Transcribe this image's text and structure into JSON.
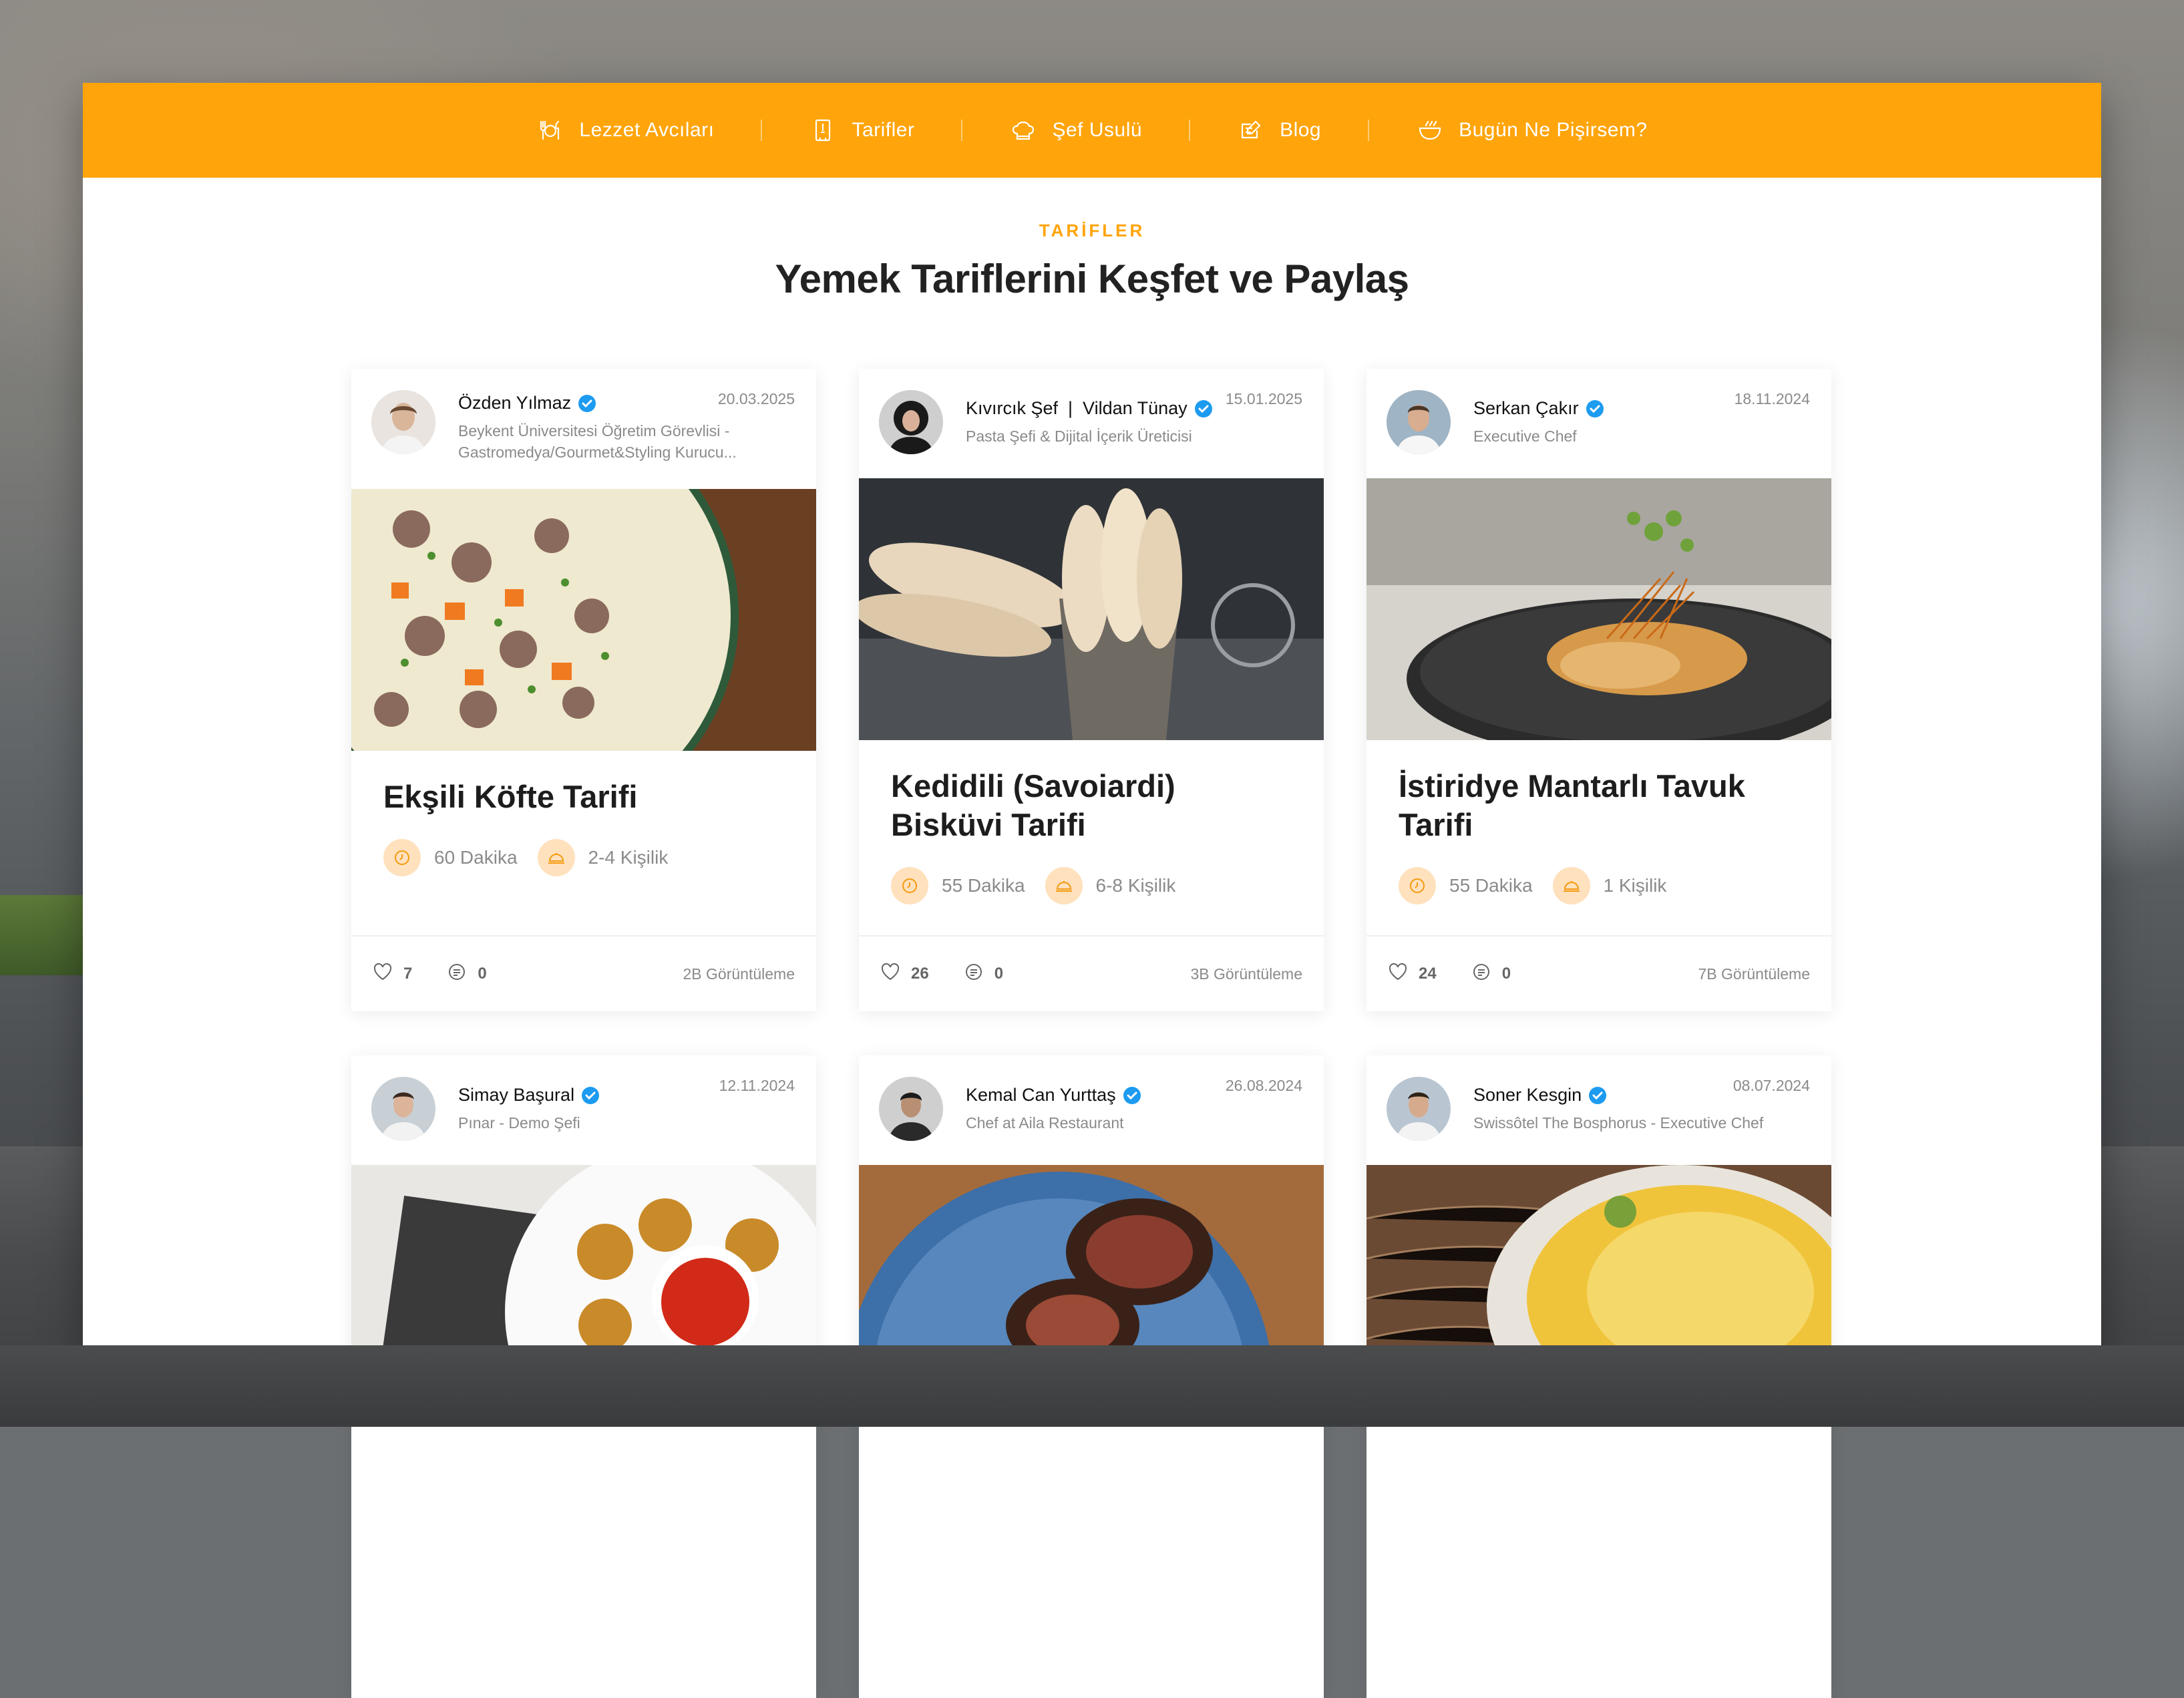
{
  "nav": {
    "items": [
      {
        "label": "Lezzet Avcıları",
        "icon": "cutlery-icon"
      },
      {
        "label": "Tarifler",
        "icon": "recipe-book-icon"
      },
      {
        "label": "Şef Usulü",
        "icon": "chef-hat-icon"
      },
      {
        "label": "Blog",
        "icon": "blog-edit-icon"
      },
      {
        "label": "Bugün Ne Pişirsem?",
        "icon": "pot-icon"
      }
    ]
  },
  "header": {
    "eyebrow": "TARİFLER",
    "title": "Yemek Tariflerini Keşfet ve Paylaş"
  },
  "colors": {
    "accent": "#ffa40a",
    "meta_icon_bg": "#ffe1bd",
    "verified": "#1d9bf0"
  },
  "cards": [
    {
      "author": "Özden Yılmaz",
      "bio": "Beykent Üniversitesi Öğretim Görevlisi -\nGastromedya/Gourmet&Styling Kurucu...",
      "date": "20.03.2025",
      "title": "Ekşili Köfte Tarifi",
      "duration": "60 Dakika",
      "servings": "2-4 Kişilik",
      "likes": "7",
      "comments": "0",
      "views": "2B Görüntüleme"
    },
    {
      "author": "Kıvırcık Şef  |  Vildan Tünay",
      "bio": "Pasta Şefi & Dijital İçerik Üreticisi",
      "date": "15.01.2025",
      "title": "Kedidili (Savoiardi) Bisküvi Tarifi",
      "duration": "55 Dakika",
      "servings": "6-8 Kişilik",
      "likes": "26",
      "comments": "0",
      "views": "3B Görüntüleme"
    },
    {
      "author": "Serkan Çakır",
      "bio": "Executive Chef",
      "date": "18.11.2024",
      "title": "İstiridye Mantarlı Tavuk Tarifi",
      "duration": "55 Dakika",
      "servings": "1 Kişilik",
      "likes": "24",
      "comments": "0",
      "views": "7B Görüntüleme"
    },
    {
      "author": "Simay Başural",
      "bio": "Pınar - Demo Şefi",
      "date": "12.11.2024",
      "title": "",
      "duration": "",
      "servings": "",
      "likes": "",
      "comments": "",
      "views": ""
    },
    {
      "author": "Kemal Can Yurttaş",
      "bio": "Chef at Aila Restaurant",
      "date": "26.08.2024",
      "title": "",
      "duration": "",
      "servings": "",
      "likes": "",
      "comments": "",
      "views": ""
    },
    {
      "author": "Soner Kesgin",
      "bio": "Swissôtel The Bosphorus - Executive Chef",
      "date": "08.07.2024",
      "title": "",
      "duration": "",
      "servings": "",
      "likes": "",
      "comments": "",
      "views": ""
    }
  ]
}
